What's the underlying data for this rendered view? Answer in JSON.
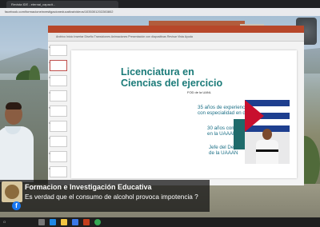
{
  "browser": {
    "tab_title": "Revista IDE - eternal_capacit...",
    "url": "facebook.com/formacioneinvestigacioneducativa/videos/1035301202283802"
  },
  "powerpoint": {
    "ribbon_text": "Archivo  Inicio  Insertar  Diseño  Transiciones  Animaciones  Presentación con diapositivas  Revisar  Vista  Ayuda"
  },
  "thumbnails": {
    "numbers": [
      "1",
      "2",
      "3",
      "4",
      "5",
      "6",
      "7",
      "8",
      "9"
    ],
    "selected_index": 1
  },
  "slide": {
    "title": "Licenciatura en\nCiencias del ejercicio",
    "subtitle": "FOD de la UANL",
    "line1": "35 años de experiencia como entrenador\ncon especialidad en deportes de combate",
    "line2": "30 años como Técnico Académico\nen la UAAAN",
    "line3": "Jefe del Departamento Deportivo\nde la UAAAN",
    "colors": {
      "title": "#1a7a78",
      "text": "#1b6f86",
      "accent_bar": "#1f6b6b"
    }
  },
  "stream": {
    "page_name": "Formacion e Investigación Educativa",
    "question": "Es verdad que el consumo de alcohol provoca impotencia ?",
    "network_icon": "facebook-icon"
  },
  "taskbar": {
    "search_label": "O",
    "icons": [
      "search-icon",
      "task-view-icon",
      "edge-icon",
      "explorer-icon",
      "store-icon",
      "powerpoint-icon",
      "chrome-icon"
    ]
  }
}
